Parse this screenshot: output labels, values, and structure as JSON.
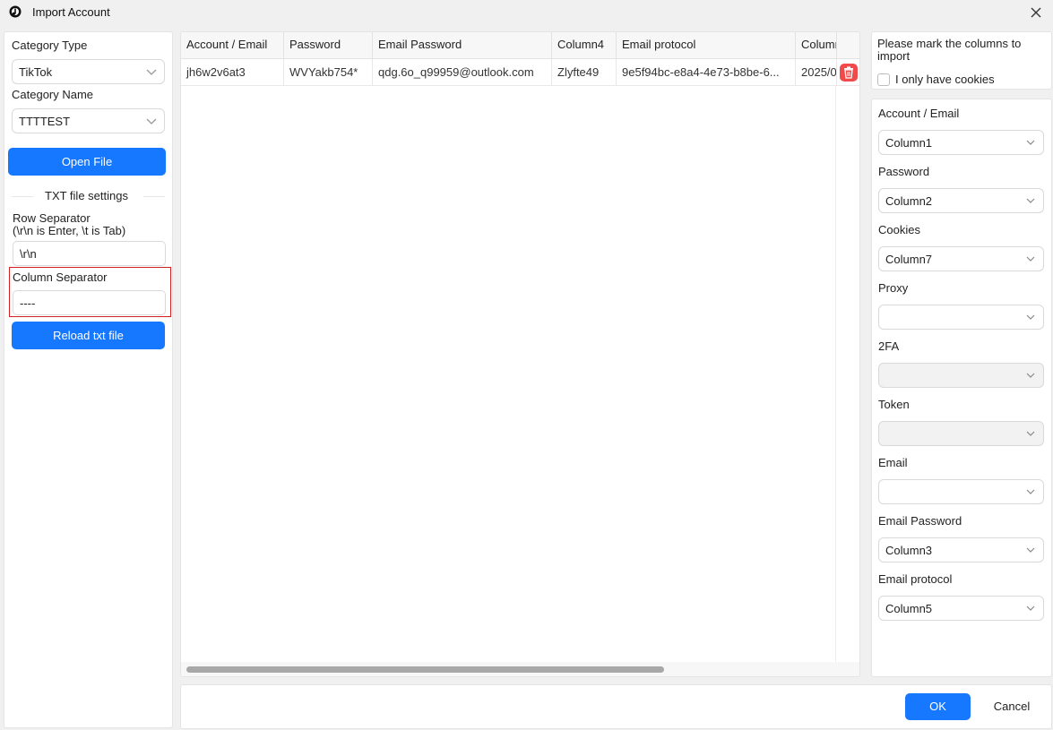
{
  "window": {
    "title": "Import Account",
    "app_icon": "tiktok-logo-icon",
    "close_icon": "close-icon"
  },
  "left": {
    "category_type_label": "Category Type",
    "category_type_value": "TikTok",
    "category_name_label": "Category Name",
    "category_name_value": "TTTTEST",
    "open_file_label": "Open File",
    "txt_settings_label": "TXT file settings",
    "row_separator_label_1": "Row Separator",
    "row_separator_label_2": "(\\r\\n is Enter, \\t is Tab)",
    "row_separator_value": "\\r\\n",
    "column_separator_label": "Column Separator",
    "column_separator_value": "----",
    "reload_label": "Reload txt file"
  },
  "table": {
    "columns": [
      "Account / Email",
      "Password",
      "Email Password",
      "Column4",
      "Email protocol",
      "Column"
    ],
    "rows": [
      [
        "jh6w2v6at3",
        "WVYakb754*",
        "qdg.6o_q99959@outlook.com",
        "Zlyfte49",
        "9e5f94bc-e8a4-4e73-b8be-6...",
        "2025/0"
      ]
    ],
    "delete_icon": "trash-icon"
  },
  "right": {
    "instruction": "Please mark the columns to import",
    "cookies_only_label": "I only have cookies",
    "fields": [
      {
        "label": "Account / Email",
        "value": "Column1"
      },
      {
        "label": "Password",
        "value": "Column2"
      },
      {
        "label": "Cookies",
        "value": "Column7"
      },
      {
        "label": "Proxy",
        "value": ""
      },
      {
        "label": "2FA",
        "value": ""
      },
      {
        "label": "Token",
        "value": ""
      },
      {
        "label": "Email",
        "value": ""
      },
      {
        "label": "Email Password",
        "value": "Column3"
      },
      {
        "label": "Email protocol",
        "value": "Column5"
      }
    ]
  },
  "footer": {
    "ok_label": "OK",
    "cancel_label": "Cancel"
  },
  "colors": {
    "primary": "#1677ff",
    "highlight": "#d32020",
    "delete": "#f04a4a"
  }
}
